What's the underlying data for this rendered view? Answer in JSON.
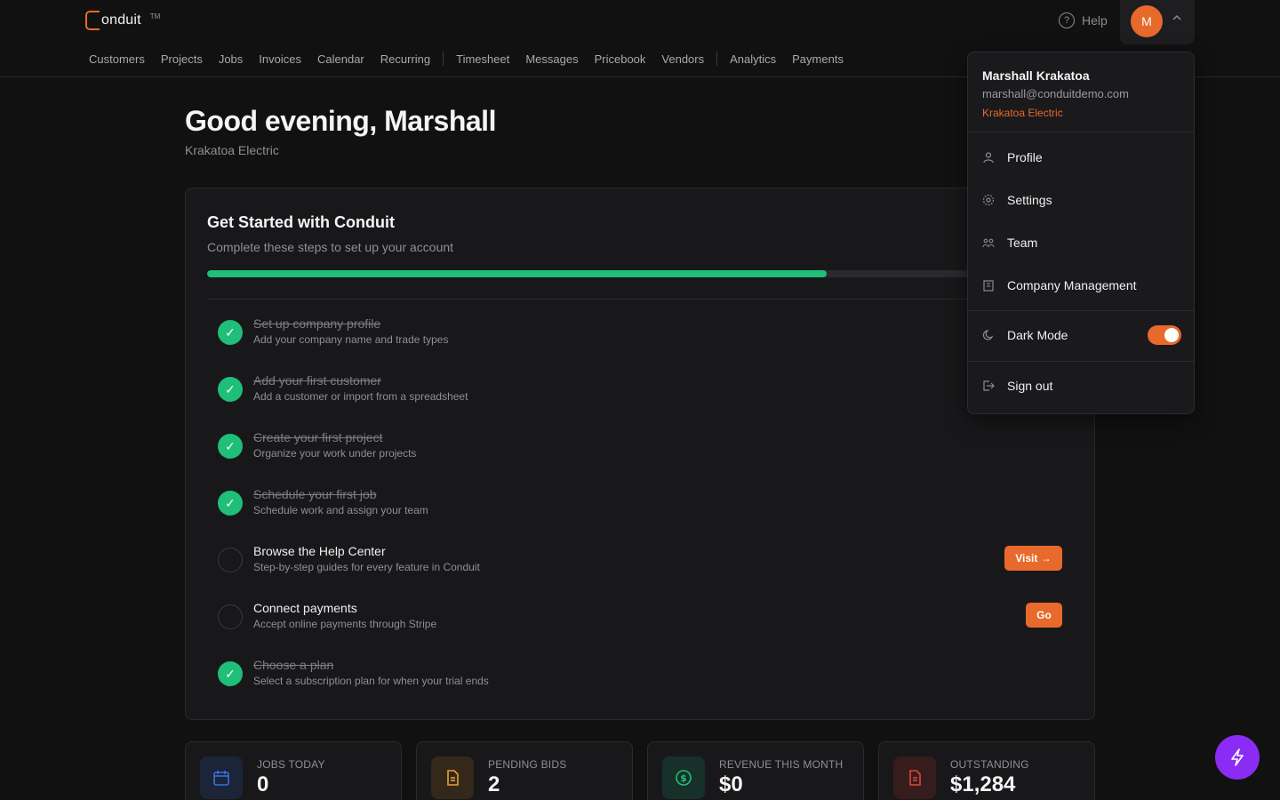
{
  "app": {
    "logo_text": "onduit",
    "logo_tm": "TM"
  },
  "nav": {
    "items": [
      "Customers",
      "Projects",
      "Jobs",
      "Invoices",
      "Calendar",
      "Recurring",
      "Timesheet",
      "Messages",
      "Pricebook",
      "Vendors",
      "Analytics",
      "Payments"
    ]
  },
  "header": {
    "help_label": "Help",
    "avatar_initial": "M"
  },
  "main": {
    "greeting": "Good evening, Marshall",
    "company": "Krakatoa Electric"
  },
  "onboarding": {
    "title": "Get Started with Conduit",
    "subtitle": "Complete these steps to set up your account",
    "progress_fraction": 0.714,
    "steps": [
      {
        "title": "Set up company profile",
        "desc": "Add your company name and trade types",
        "done": true
      },
      {
        "title": "Add your first customer",
        "desc": "Add a customer or import from a spreadsheet",
        "done": true
      },
      {
        "title": "Create your first project",
        "desc": "Organize your work under projects",
        "done": true
      },
      {
        "title": "Schedule your first job",
        "desc": "Schedule work and assign your team",
        "done": true
      },
      {
        "title": "Browse the Help Center",
        "desc": "Step-by-step guides for every feature in Conduit",
        "done": false,
        "action": "Visit →"
      },
      {
        "title": "Connect payments",
        "desc": "Accept online payments through Stripe",
        "done": false,
        "action": "Go"
      },
      {
        "title": "Choose a plan",
        "desc": "Select a subscription plan for when your trial ends",
        "done": true
      }
    ]
  },
  "stats": [
    {
      "label": "JOBS TODAY",
      "value": "0",
      "icon": "calendar-icon",
      "color": "#3b6fe0"
    },
    {
      "label": "PENDING BIDS",
      "value": "2",
      "icon": "document-icon",
      "color": "#e8a22c"
    },
    {
      "label": "REVENUE THIS MONTH",
      "value": "$0",
      "icon": "dollar-icon",
      "color": "#1fbf7a"
    },
    {
      "label": "OUTSTANDING",
      "value": "$1,284",
      "icon": "invoice-icon",
      "color": "#e0443b"
    }
  ],
  "user_menu": {
    "name": "Marshall Krakatoa",
    "email": "marshall@conduitdemo.com",
    "company": "Krakatoa Electric",
    "items": [
      "Profile",
      "Settings",
      "Team",
      "Company Management"
    ],
    "dark_mode_label": "Dark Mode",
    "dark_mode_on": true,
    "sign_out_label": "Sign out"
  },
  "colors": {
    "accent": "#e8692c",
    "success": "#1fbf7a",
    "fab": "#8b2cf5"
  }
}
